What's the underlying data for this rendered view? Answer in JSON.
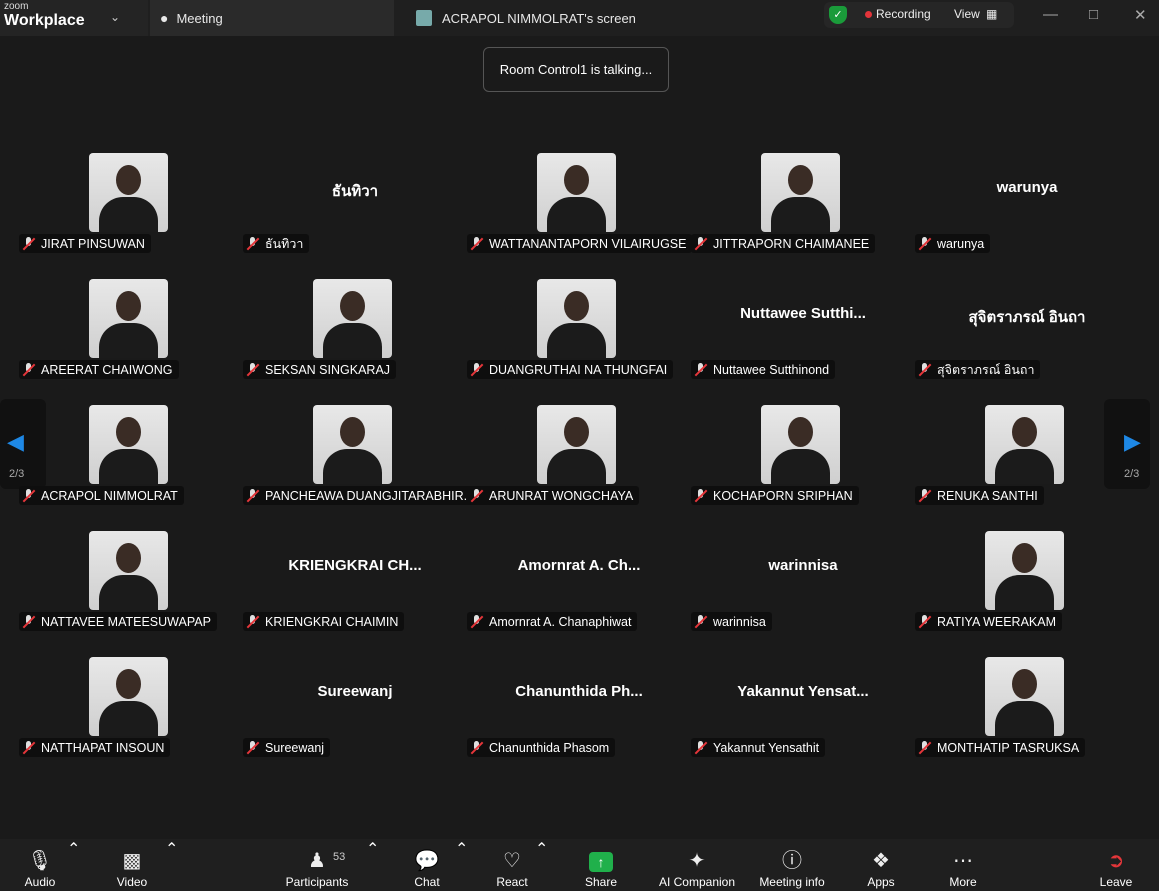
{
  "app": {
    "brand_small": "zoom",
    "brand_large": "Workplace"
  },
  "tabs": [
    {
      "label": "Meeting",
      "icon": "meeting-icon"
    },
    {
      "label": "ACRAPOL NIMMOLRAT's screen",
      "icon": "screen-share-avatar"
    }
  ],
  "status": {
    "recording_label": "Recording",
    "view_label": "View"
  },
  "notification": "Room Control1 is talking...",
  "pager": {
    "page": "2/3"
  },
  "participants": [
    {
      "label": "JIRAT PINSUWAN",
      "video": true
    },
    {
      "label": "ธันทิวา",
      "video": false,
      "display": "ธันทิวา"
    },
    {
      "label": "WATTANANTAPORN VILAIRUGSE",
      "video": true
    },
    {
      "label": "JITTRAPORN CHAIMANEE",
      "video": true
    },
    {
      "label": "warunya",
      "video": false,
      "display": "warunya"
    },
    {
      "label": "AREERAT CHAIWONG",
      "video": true
    },
    {
      "label": "SEKSAN SINGKARAJ",
      "video": true
    },
    {
      "label": "DUANGRUTHAI NA THUNGFAI",
      "video": true
    },
    {
      "label": "Nuttawee Sutthinond",
      "video": false,
      "display": "Nuttawee  Sutthi..."
    },
    {
      "label": "สุจิตราภรณ์ อินถา",
      "video": false,
      "display": "สุจิตราภรณ์ อินถา"
    },
    {
      "label": "ACRAPOL NIMMOLRAT",
      "video": true
    },
    {
      "label": "PANCHEAWA DUANGJITARABHIR...",
      "video": true
    },
    {
      "label": "ARUNRAT WONGCHAYA",
      "video": true
    },
    {
      "label": "KOCHAPORN SRIPHAN",
      "video": true
    },
    {
      "label": "RENUKA SANTHI",
      "video": true
    },
    {
      "label": "NATTAVEE MATEESUWAPAP",
      "video": true
    },
    {
      "label": "KRIENGKRAI CHAIMIN",
      "video": false,
      "display": "KRIENGKRAI  CH..."
    },
    {
      "label": "Amornrat A. Chanaphiwat",
      "video": false,
      "display": "Amornrat  A.  Ch..."
    },
    {
      "label": "warinnisa",
      "video": false,
      "display": "warinnisa"
    },
    {
      "label": "RATIYA WEERAKAM",
      "video": true
    },
    {
      "label": "NATTHAPAT INSOUN",
      "video": true
    },
    {
      "label": "Sureewanj",
      "video": false,
      "display": "Sureewanj"
    },
    {
      "label": "Chanunthida Phasom",
      "video": false,
      "display": "Chanunthida  Ph..."
    },
    {
      "label": "Yakannut Yensathit",
      "video": false,
      "display": "Yakannut  Yensat..."
    },
    {
      "label": "MONTHATIP TASRUKSA",
      "video": true
    }
  ],
  "toolbar": {
    "audio": "Audio",
    "video": "Video",
    "participants": "Participants",
    "participants_count": "53",
    "chat": "Chat",
    "react": "React",
    "share": "Share",
    "ai_companion": "AI Companion",
    "meeting_info": "Meeting info",
    "apps": "Apps",
    "more": "More",
    "leave": "Leave"
  },
  "colors": {
    "accent": "#1e88e5",
    "recording": "#e3343a",
    "share": "#20b04b",
    "muted": "#e5363a"
  }
}
